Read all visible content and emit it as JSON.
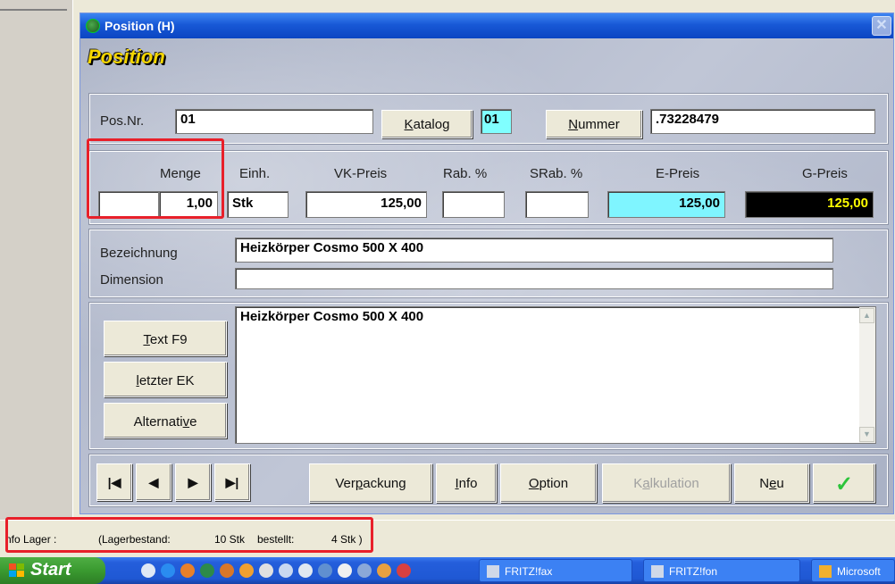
{
  "window": {
    "title": "Position (H)",
    "heading": "Position"
  },
  "position": {
    "pos_nr_label": "Pos.Nr.",
    "pos_nr_value": "01",
    "katalog_label": "Katalog",
    "katalog_value": "01",
    "nummer_label": "Nummer",
    "nummer_value": ".73228479"
  },
  "pricing": {
    "menge_label": "Menge",
    "menge_prefix": "",
    "menge_value": "1,00",
    "einh_label": "Einh.",
    "einh_value": "Stk",
    "vk_label": "VK-Preis",
    "vk_value": "125,00",
    "rab_label": "Rab. %",
    "rab_value": "",
    "srab_label": "SRab. %",
    "srab_value": "",
    "epreis_label": "E-Preis",
    "epreis_value": "125,00",
    "gpreis_label": "G-Preis",
    "gpreis_value": "125,00"
  },
  "description": {
    "bezeichnung_label": "Bezeichnung",
    "bezeichnung_value": "Heizkörper Cosmo 500 X 400",
    "dimension_label": "Dimension",
    "dimension_value": ""
  },
  "text_section": {
    "text_button": "Text F9",
    "letzter_ek_button": "letzter EK",
    "alternative_button": "Alternative",
    "text_content": "Heizkörper Cosmo 500 X 400"
  },
  "toolbar": {
    "first": "|◀",
    "prev": "◀",
    "next": "▶",
    "last": "▶|",
    "verpackung": "Verpackung",
    "info": "Info",
    "option": "Option",
    "kalkulation": "Kalkulation",
    "neu": "Neu",
    "ok": "✓"
  },
  "status": {
    "info_lager": "nfo Lager :",
    "lagerbestand_label": "(Lagerbestand:",
    "lagerbestand_value": "10 Stk",
    "bestellt_label": "bestellt:",
    "bestellt_value": "4 Stk )"
  },
  "taskbar": {
    "start": "Start",
    "items": [
      "FRITZ!fax",
      "FRITZ!fon",
      "Microsoft"
    ]
  },
  "colors": {
    "epreis_bg": "#7ff5ff",
    "katalog_bg": "#80ffff",
    "gpreis_bg": "#000000",
    "gpreis_fg": "#ffff00",
    "highlight": "#e8202a"
  }
}
